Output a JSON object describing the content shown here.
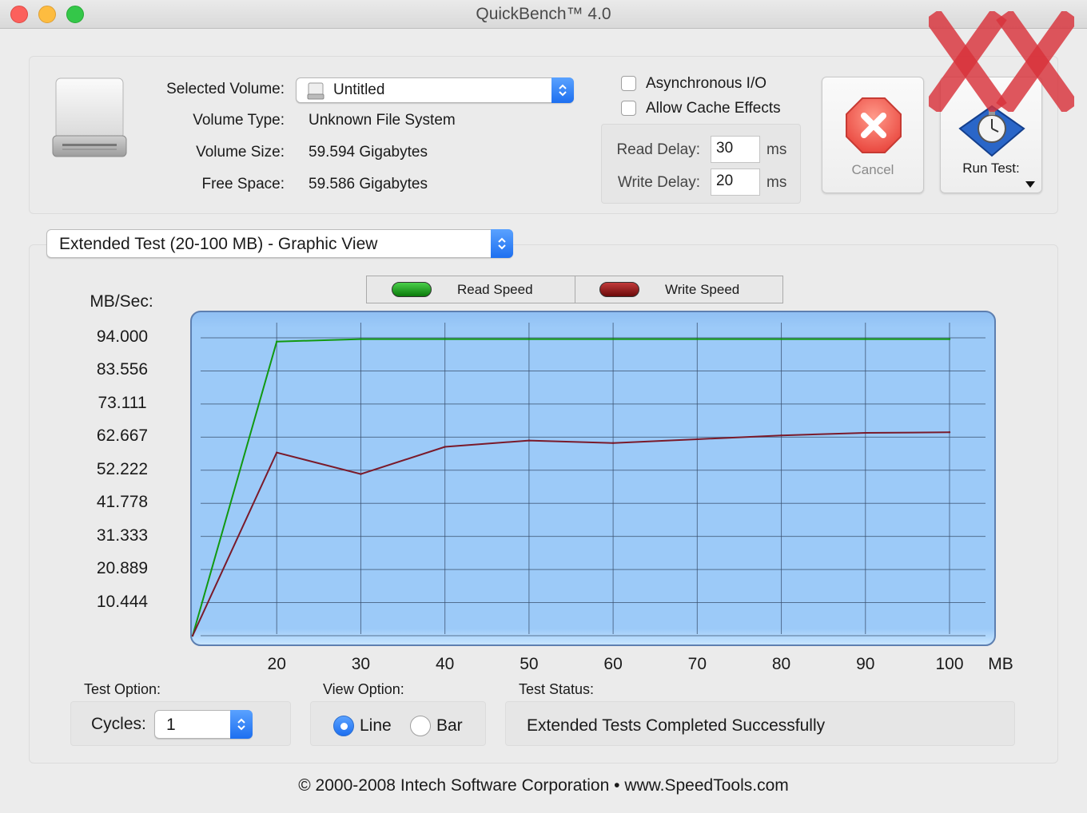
{
  "window": {
    "title": "QuickBench™ 4.0"
  },
  "volume": {
    "selected_label": "Selected Volume:",
    "selected_value": "Untitled",
    "type_label": "Volume Type:",
    "type_value": "Unknown File System",
    "size_label": "Volume Size:",
    "size_value": "59.594 Gigabytes",
    "free_label": "Free Space:",
    "free_value": "59.586 Gigabytes"
  },
  "options": {
    "async_label": "Asynchronous I/O",
    "async_checked": false,
    "cache_label": "Allow Cache Effects",
    "cache_checked": false,
    "read_delay_label": "Read Delay:",
    "read_delay_value": "30",
    "write_delay_label": "Write Delay:",
    "write_delay_value": "20",
    "unit": "ms"
  },
  "buttons": {
    "cancel": "Cancel",
    "run": "Run Test:"
  },
  "test_mode": "Extended Test (20-100 MB) - Graphic View",
  "legend": {
    "read": "Read Speed",
    "write": "Write Speed",
    "read_color": "#0a9a0a",
    "write_color": "#9b0a0a"
  },
  "chart_data": {
    "type": "line",
    "ylabel": "MB/Sec:",
    "xlabel": "MB",
    "ylim": [
      0,
      98
    ],
    "xlim": [
      10,
      105
    ],
    "yticks": [
      "94.000",
      "83.556",
      "73.111",
      "62.667",
      "52.222",
      "41.778",
      "31.333",
      "20.889",
      "10.444"
    ],
    "xticks": [
      "20",
      "30",
      "40",
      "50",
      "60",
      "70",
      "80",
      "90",
      "100"
    ],
    "x": [
      10,
      20,
      30,
      40,
      50,
      60,
      70,
      80,
      90,
      100
    ],
    "series": [
      {
        "name": "Read Speed",
        "color": "#119911",
        "values": [
          0,
          92.8,
          93.6,
          93.6,
          93.6,
          93.6,
          93.6,
          93.6,
          93.6,
          93.6
        ]
      },
      {
        "name": "Write Speed",
        "color": "#7a1a2a",
        "values": [
          0,
          57.8,
          51.0,
          59.6,
          61.6,
          60.8,
          62.0,
          63.2,
          64.0,
          64.2
        ]
      }
    ],
    "grid": true
  },
  "bottom": {
    "test_option_label": "Test Option:",
    "cycles_label": "Cycles:",
    "cycles_value": "1",
    "view_option_label": "View Option:",
    "view_line": "Line",
    "view_bar": "Bar",
    "view_selected": "Line",
    "status_label": "Test Status:",
    "status_value": "Extended Tests Completed Successfully"
  },
  "footer": "© 2000-2008 Intech Software Corporation • www.SpeedTools.com"
}
